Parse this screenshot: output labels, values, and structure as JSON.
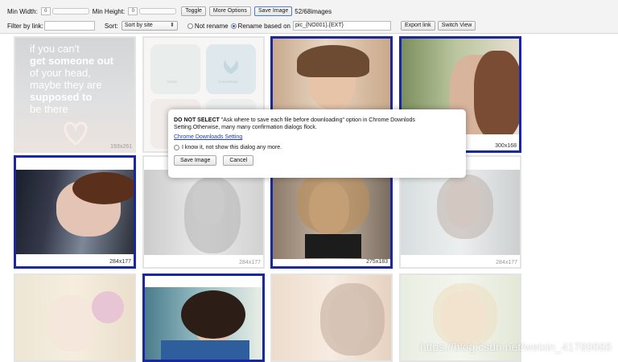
{
  "toolbar": {
    "min_width_label": "Min Width:",
    "min_width_value": "0",
    "min_height_label": "Min Height:",
    "min_height_value": "0",
    "toggle_label": "Toggle",
    "more_options_label": "More Options",
    "save_image_label": "Save Image",
    "image_count": "52/68images",
    "filter_label": "Filter by link:",
    "filter_value": "",
    "sort_label": "Sort:",
    "sort_selected": "Sort by site",
    "not_rename_label": "Not rename",
    "rename_label": "Rename based on",
    "rename_pattern": "pic_{NO001}.{EXT}",
    "export_link_label": "Export link",
    "switch_view_label": "Switch View"
  },
  "images": [
    {
      "dim": "193x261",
      "selected": false,
      "faded": true
    },
    {
      "dim": "",
      "selected": false,
      "faded": true
    },
    {
      "dim": "",
      "selected": true,
      "faded": false
    },
    {
      "dim": "300x168",
      "selected": true,
      "faded": false
    },
    {
      "dim": "284x177",
      "selected": true,
      "faded": false
    },
    {
      "dim": "284x177",
      "selected": false,
      "faded": true
    },
    {
      "dim": "275x183",
      "selected": true,
      "faded": false
    },
    {
      "dim": "284x177",
      "selected": false,
      "faded": true
    },
    {
      "dim": "",
      "selected": false,
      "faded": true
    },
    {
      "dim": "",
      "selected": true,
      "faded": false
    },
    {
      "dim": "",
      "selected": false,
      "faded": true
    },
    {
      "dim": "",
      "selected": false,
      "faded": true
    }
  ],
  "quote_lines": [
    "if you can't",
    "get someone out",
    "of your head,",
    "maybe they are",
    "supposed to",
    "be there"
  ],
  "card_labels": [
    "TODAY",
    "TOMORROW"
  ],
  "dialog": {
    "warning_bold": "DO NOT SELECT",
    "warning_text": " \"Ask where to save each file before downloading\" option in Chrome Downlods Setting.Otherwise, many many confirmation dialogs flock.",
    "link_label": "Chrome Downloads Setting",
    "checkbox_label": "I know it, not show this dialog any more.",
    "save_label": "Save Image",
    "cancel_label": "Cancel"
  },
  "watermark": "https://blog.csdn.net/weixin_41789688",
  "colors": {
    "selected_border": "#1a27a0",
    "toolbar_bg": "#f3f3f3",
    "link": "#1a3cc0"
  }
}
